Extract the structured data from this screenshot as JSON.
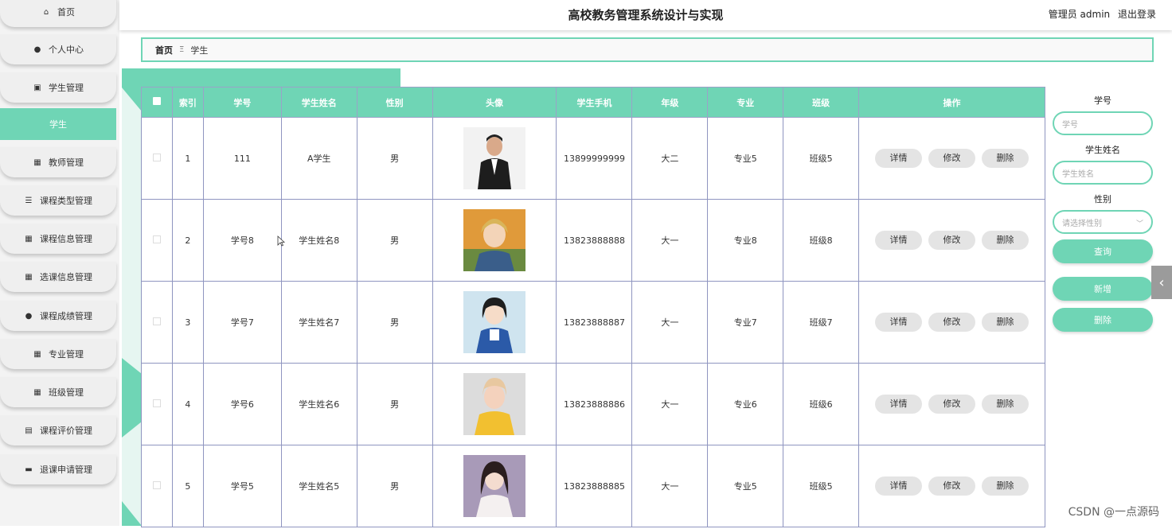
{
  "header": {
    "title": "高校教务管理系统设计与实现",
    "user": "管理员 admin",
    "logout": "退出登录"
  },
  "sidebar": {
    "items": [
      {
        "label": "首页",
        "icon": "home-icon"
      },
      {
        "label": "个人中心",
        "icon": "user-icon"
      },
      {
        "label": "学生管理",
        "icon": "clipboard-icon"
      },
      {
        "label": "学生",
        "icon": ""
      },
      {
        "label": "教师管理",
        "icon": "grid-icon"
      },
      {
        "label": "课程类型管理",
        "icon": "list-icon"
      },
      {
        "label": "课程信息管理",
        "icon": "grid-icon"
      },
      {
        "label": "选课信息管理",
        "icon": "grid-icon"
      },
      {
        "label": "课程成绩管理",
        "icon": "user-icon"
      },
      {
        "label": "专业管理",
        "icon": "grid-icon"
      },
      {
        "label": "班级管理",
        "icon": "grid-icon"
      },
      {
        "label": "课程评价管理",
        "icon": "wallet-icon"
      },
      {
        "label": "退课申请管理",
        "icon": "briefcase-icon"
      }
    ]
  },
  "breadcrumb": {
    "home": "首页",
    "sep": "Ξ",
    "current": "学生"
  },
  "table": {
    "headers": [
      "索引",
      "学号",
      "学生姓名",
      "性别",
      "头像",
      "学生手机",
      "年级",
      "专业",
      "班级",
      "操作"
    ],
    "actions": {
      "detail": "详情",
      "edit": "修改",
      "delete": "删除"
    },
    "rows": [
      {
        "index": "1",
        "id": "111",
        "name": "A学生",
        "gender": "男",
        "phone": "13899999999",
        "grade": "大二",
        "major": "专业5",
        "class": "班级5"
      },
      {
        "index": "2",
        "id": "学号8",
        "name": "学生姓名8",
        "gender": "男",
        "phone": "13823888888",
        "grade": "大一",
        "major": "专业8",
        "class": "班级8"
      },
      {
        "index": "3",
        "id": "学号7",
        "name": "学生姓名7",
        "gender": "男",
        "phone": "13823888887",
        "grade": "大一",
        "major": "专业7",
        "class": "班级7"
      },
      {
        "index": "4",
        "id": "学号6",
        "name": "学生姓名6",
        "gender": "男",
        "phone": "13823888886",
        "grade": "大一",
        "major": "专业6",
        "class": "班级6"
      },
      {
        "index": "5",
        "id": "学号5",
        "name": "学生姓名5",
        "gender": "男",
        "phone": "13823888885",
        "grade": "大一",
        "major": "专业5",
        "class": "班级5"
      }
    ]
  },
  "search": {
    "id_label": "学号",
    "id_placeholder": "学号",
    "name_label": "学生姓名",
    "name_placeholder": "学生姓名",
    "gender_label": "性别",
    "gender_placeholder": "请选择性别",
    "query": "查询",
    "add": "新增",
    "delete": "删除"
  },
  "watermark": "CSDN @一点源码"
}
